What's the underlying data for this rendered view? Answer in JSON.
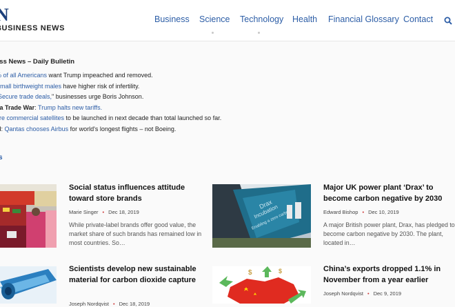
{
  "header": {
    "logo_mark": "N",
    "logo_text": "BUSINESS NEWS",
    "nav": [
      {
        "label": "Business"
      },
      {
        "label": "Science"
      },
      {
        "label": "Technology"
      },
      {
        "label": "Health"
      },
      {
        "label": "Financial Glossary"
      },
      {
        "label": "Contact"
      }
    ],
    "search_icon": "search-icon"
  },
  "bulletin": {
    "title": "ess News – Daily Bulletin",
    "lines": [
      {
        "link": "% of all Americans",
        "text": " want Trump impeached and removed."
      },
      {
        "link": "Small birthweight males",
        "text": " have higher risk of infertility."
      },
      {
        "link": "Secure trade deals,",
        "text": "\" businesses urge Boris Johnson."
      },
      {
        "prefix": "na Trade War",
        "link": "Trump halts new tariffs.",
        "text": ""
      },
      {
        "link": "ore commercial satellites",
        "text": " to be launched in next decade than total launched so far."
      },
      {
        "prefix": "el",
        "link": "Qantas chooses Airbus",
        "text": " for world's longest flights – not Boeing."
      }
    ]
  },
  "section_label": "s",
  "articles": [
    {
      "title": "Social status influences attitude toward store brands",
      "author": "Marie Singer",
      "date": "Dec 18, 2019",
      "excerpt": "While private-label brands offer good value, the market share of such brands has remained low in most countries. So…"
    },
    {
      "title": "Major UK power plant ‘Drax’ to become carbon negative by 2030",
      "author": "Edward Bishop",
      "date": "Dec 10, 2019",
      "excerpt": "A major British power plant, Drax, has pledged to become carbon negative by 2030. The plant, located in…"
    },
    {
      "title": "Scientists develop new sustainable material for carbon dioxide capture",
      "author": "Joseph Nordqvist",
      "date": "Dec 18, 2019",
      "excerpt": ""
    },
    {
      "title": "China’s exports dropped 1.1% in November from a year earlier",
      "author": "Joseph Nordqvist",
      "date": "Dec 9, 2019",
      "excerpt": ""
    }
  ],
  "colors": {
    "link": "#2c5da6",
    "accent": "#c33",
    "logo": "#1c3f7a"
  }
}
